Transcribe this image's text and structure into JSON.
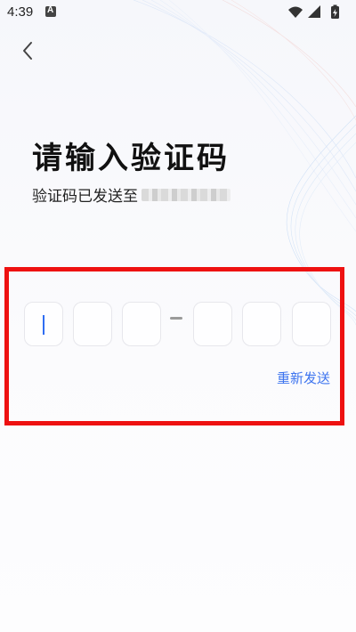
{
  "status_bar": {
    "time": "4:39",
    "icons": [
      "notification-a-icon",
      "wifi-icon",
      "signal-icon",
      "battery-charging-icon"
    ]
  },
  "header": {
    "back_icon": "chevron-left-icon"
  },
  "main": {
    "title": "请输入验证码",
    "subtitle": "验证码已发送至",
    "phone_masked": "blurred-phone-number",
    "code_digits": [
      "",
      "",
      "",
      "",
      "",
      ""
    ],
    "resend_label": "重新发送"
  },
  "colors": {
    "accent": "#3d74ef",
    "highlight": "#ee1111",
    "title": "#111111"
  }
}
